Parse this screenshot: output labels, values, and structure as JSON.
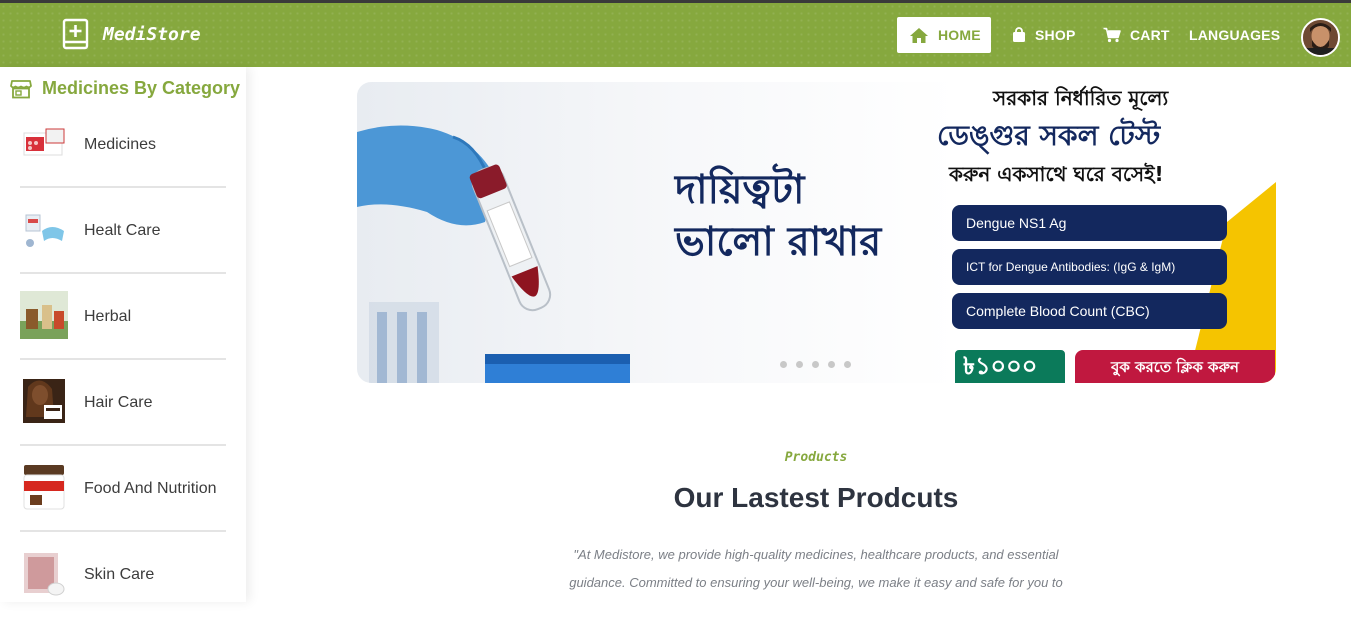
{
  "brand": {
    "name": "MediStore",
    "icon": "book-plus-icon"
  },
  "nav": [
    {
      "label": "HOME",
      "icon": "home-icon",
      "active": true
    },
    {
      "label": "SHOP",
      "icon": "shopping-bag-icon",
      "active": false
    },
    {
      "label": "CART",
      "icon": "cart-icon",
      "active": false
    },
    {
      "label": "LANGUAGES",
      "icon": "",
      "active": false
    }
  ],
  "sidebar": {
    "title": "Medicines By Category",
    "icon": "store-icon",
    "items": [
      {
        "label": "Medicines"
      },
      {
        "label": "Healt Care"
      },
      {
        "label": "Herbal"
      },
      {
        "label": "Hair Care"
      },
      {
        "label": "Food And Nutrition"
      },
      {
        "label": "Skin Care"
      }
    ]
  },
  "banner": {
    "headline_1": "সরকার নির্ধারিত মূল্যে",
    "headline_2": "ডেঙ্গুর সকল টেস্ট",
    "headline_3": "করুন একসাথে ঘরে বসেই!",
    "slogan": "দায়িত্বটা ভালো রাখার",
    "tests": [
      "Dengue NS1 Ag",
      "ICT for Dengue Antibodies: (IgG & IgM)",
      "Complete Blood Count (CBC)"
    ],
    "price": "৳১০০০",
    "book_button": "বুক করতে ক্লিক করুন",
    "slide_count": 5
  },
  "products": {
    "eyebrow": "Products",
    "title": "Our Lastest Prodcuts",
    "description": "\"At Medistore, we provide high-quality medicines, healthcare products, and essential guidance. Committed to ensuring your well-being, we make it easy and safe for you to"
  },
  "colors": {
    "brand_green": "#86a83e",
    "navy": "#13285e",
    "red": "#c0183f",
    "teal": "#0b7a5a",
    "yellow": "#f5c400"
  }
}
